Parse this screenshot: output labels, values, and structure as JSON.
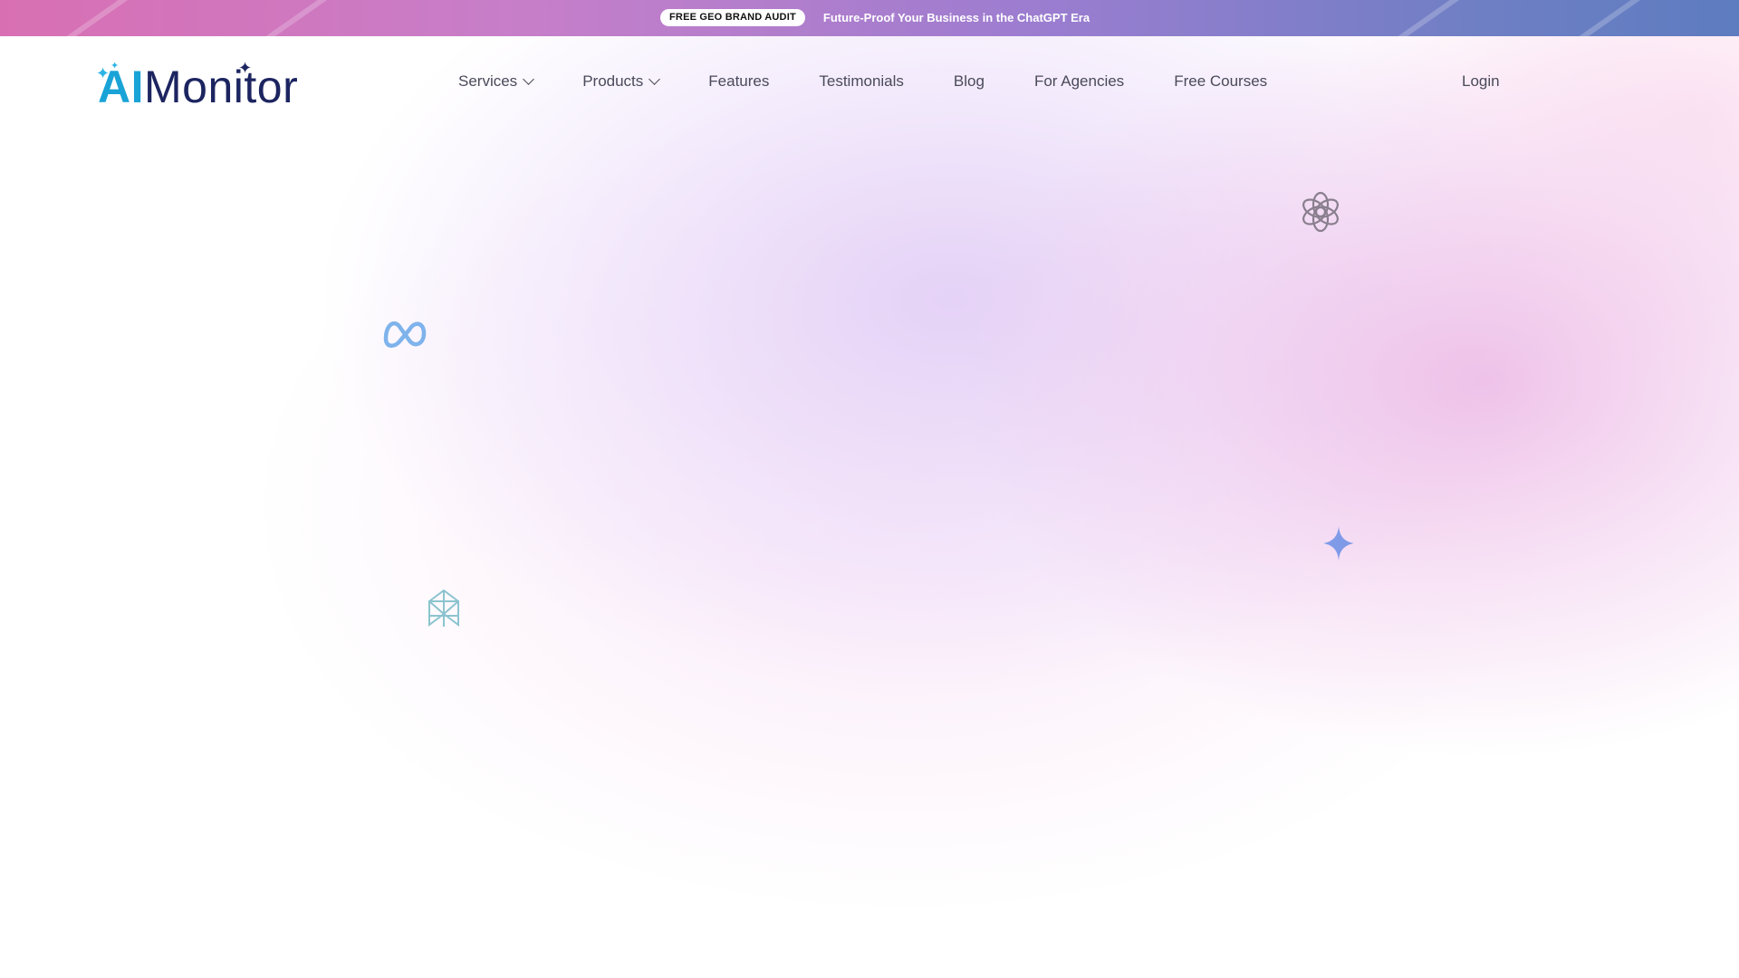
{
  "announcement": {
    "badge": "FREE GEO BRAND AUDIT",
    "text": "Future-Proof Your Business in the ChatGPT Era"
  },
  "brand": {
    "logo_prefix": "AI",
    "logo_suffix": "Monitor",
    "colors": {
      "primary": "#1c2560",
      "accent": "#1aa3d6"
    }
  },
  "nav": {
    "items": [
      {
        "label": "Services",
        "has_dropdown": true
      },
      {
        "label": "Products",
        "has_dropdown": true
      },
      {
        "label": "Features",
        "has_dropdown": false
      },
      {
        "label": "Testimonials",
        "has_dropdown": false
      },
      {
        "label": "Blog",
        "has_dropdown": false
      },
      {
        "label": "For Agencies",
        "has_dropdown": false
      },
      {
        "label": "Free Courses",
        "has_dropdown": false
      }
    ],
    "login": "Login"
  },
  "floating_icons": [
    {
      "name": "openai-icon",
      "color": "#8a7f8e"
    },
    {
      "name": "meta-icon",
      "color": "#7eb3ec"
    },
    {
      "name": "gemini-icon",
      "color": "#7f9be8"
    },
    {
      "name": "perplexity-icon",
      "color": "#8cc4cf"
    }
  ]
}
